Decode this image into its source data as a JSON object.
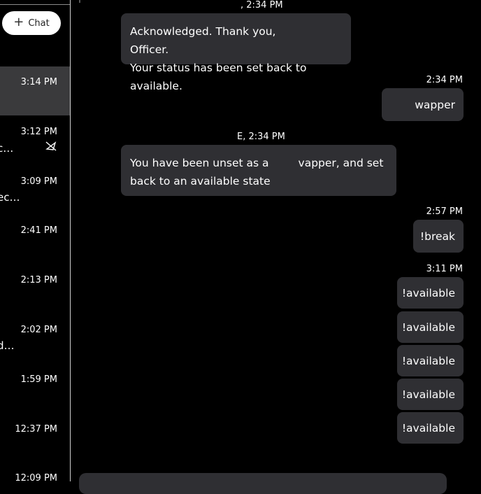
{
  "sidebar": {
    "new_chat_label": "Chat",
    "conversations": [
      {
        "time": "3:14 PM",
        "snippet": ""
      },
      {
        "time": "3:12 PM",
        "snippet": "c…",
        "muted": true
      },
      {
        "time": "3:09 PM",
        "snippet": "ec…"
      },
      {
        "time": "2:41 PM",
        "snippet": ""
      },
      {
        "time": "2:13 PM",
        "snippet": ""
      },
      {
        "time": "2:02 PM",
        "snippet": "d…"
      },
      {
        "time": "1:59 PM",
        "snippet": ""
      },
      {
        "time": "12:37 PM",
        "snippet": ""
      },
      {
        "time": "12:09 PM",
        "snippet": ""
      }
    ]
  },
  "chat": {
    "messages": [
      {
        "direction": "incoming",
        "meta": ", 2:34 PM",
        "lines": [
          "Acknowledged. Thank you,",
          "Officer.",
          "Your status has been set back to available."
        ]
      },
      {
        "direction": "outgoing",
        "meta": "2:34 PM",
        "text": "wapper"
      },
      {
        "direction": "incoming",
        "meta": "E, 2:34 PM",
        "lines": [
          "You have been unset as a",
          "vapper, and set",
          "back to an available state"
        ]
      },
      {
        "direction": "outgoing",
        "meta": "2:57 PM",
        "text": "!break"
      },
      {
        "direction": "outgoing",
        "meta": "3:11 PM",
        "text": "!available"
      },
      {
        "direction": "outgoing",
        "meta": "",
        "text": "!available"
      },
      {
        "direction": "outgoing",
        "meta": "",
        "text": "!available"
      },
      {
        "direction": "outgoing",
        "meta": "",
        "text": "!available"
      },
      {
        "direction": "outgoing",
        "meta": "",
        "text": "!available"
      }
    ]
  }
}
